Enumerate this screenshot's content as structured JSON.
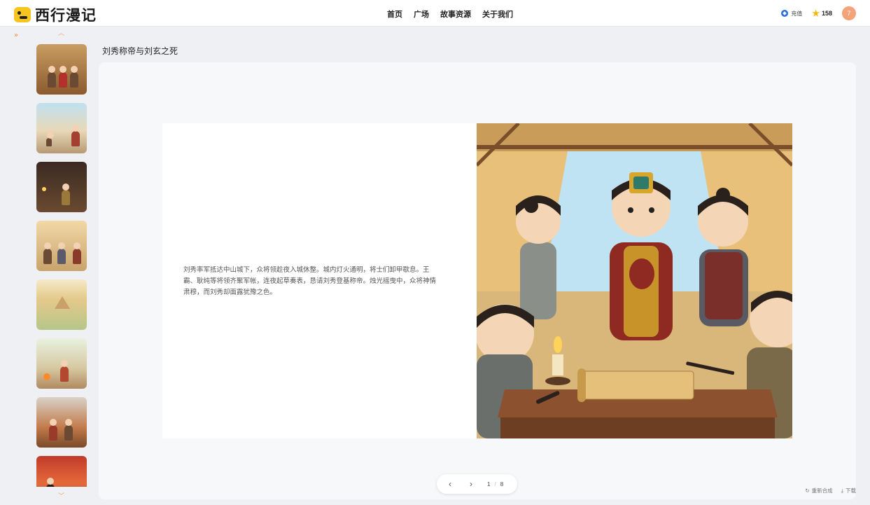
{
  "app": {
    "name": "西行漫记"
  },
  "nav": {
    "items": [
      "首页",
      "广场",
      "故事资源",
      "关于我们"
    ]
  },
  "header": {
    "recharge_label": "充值",
    "points": "158",
    "avatar_initial": "7"
  },
  "sidebar": {
    "thumbnail_count": 8
  },
  "story": {
    "title": "刘秀称帝与刘玄之死",
    "text": "刘秀率军抵达中山城下，众将领趁夜入城休整。城内灯火通明，将士们卸甲歇息。王霸、耿纯等将领齐聚军帐，连夜起草奏表，恳请刘秀登基称帝。烛光摇曳中，众将神情肃穆，而刘秀却面露犹豫之色。"
  },
  "pager": {
    "current": "1",
    "separator": "/",
    "total": "8"
  },
  "actions": {
    "regenerate": "重新合成",
    "download": "下载"
  },
  "icons": {
    "logo": "smiley-logo-icon",
    "recharge": "diamond-coin-icon",
    "points": "star-icon",
    "expand": "double-chevron-right-icon",
    "prev": "chevron-left-icon",
    "next": "chevron-right-icon",
    "regenerate": "refresh-icon",
    "download": "download-icon"
  },
  "colors": {
    "accent": "#f08a3a",
    "logo_yellow": "#f6c520",
    "avatar": "#f4a27a",
    "star": "#f5b800"
  }
}
